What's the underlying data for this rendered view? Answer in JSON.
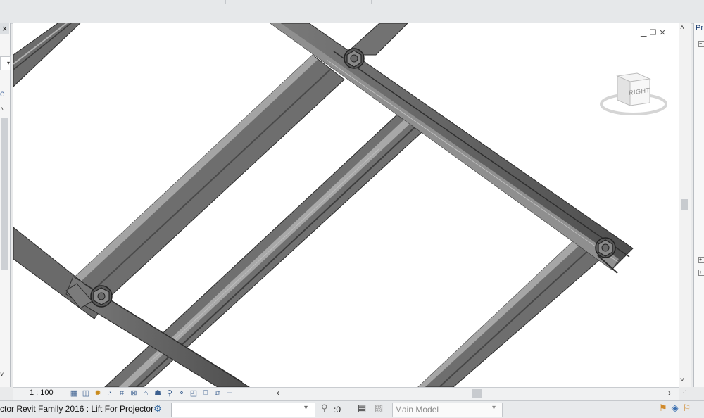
{
  "view": {
    "scale": "1 : 100",
    "viewcube_face": "RIGHT",
    "window_controls": [
      "minimize-icon",
      "restore-icon",
      "close-icon"
    ]
  },
  "left_panel": {
    "close_glyph": "×",
    "dropdown_glyph": "▾",
    "partial_text": "e",
    "scroll_up": "˄",
    "scroll_down": "˅"
  },
  "properties": {
    "title": "Pr"
  },
  "scrollbars": {
    "up": "˄",
    "down": "˅",
    "left": "‹",
    "right": "›"
  },
  "view_control_icons": [
    "detail-level-icon",
    "visual-style-icon",
    "sun-path-icon",
    "shadows-icon",
    "crop-view-icon",
    "show-crop-icon",
    "temporary-hide-icon",
    "reveal-hidden-icon",
    "lock-view-icon",
    "analytical-icon",
    "highlight-icon",
    "render-icon",
    "worksharing-icon",
    "displacement-icon",
    "reveal-constraints-icon"
  ],
  "status": {
    "text": "ctor Revit Family 2016 : Lift For Projector",
    "workset_value": "",
    "selection_count": ":0",
    "design_option": "Main Model"
  },
  "colors": {
    "steel": "#6f6f6f",
    "steel_light": "#9a9a9a",
    "steel_dark": "#3c3c3c",
    "accent": "#3b6ea5"
  }
}
